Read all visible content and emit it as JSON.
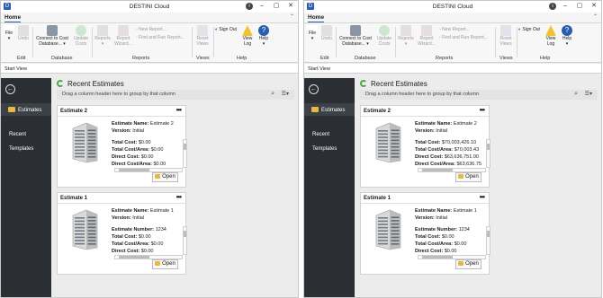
{
  "windows": [
    {
      "title": "DESTINI Cloud",
      "home_tab": "Home",
      "ribbon": {
        "file": "File",
        "undo": "Undo",
        "connect": "Connect to Cost Database...",
        "update": "Update Costs",
        "reports": "Reports",
        "report_wizard": "Report Wizard...",
        "new_report": "New Report...",
        "find_run_report": "Find and Run Report...",
        "reset_views": "Reset Views",
        "view_log": "View Log",
        "sign_out": "Sign Out",
        "help": "Help",
        "groups": {
          "edit": "Edit",
          "database": "Database",
          "reports": "Reports",
          "views": "Views",
          "help": "Help"
        }
      },
      "start_view": "Start View",
      "nav": {
        "estimates": "Estimates",
        "recent": "Recent",
        "templates": "Templates"
      },
      "main": {
        "header": "Recent Estimates",
        "group_hint": "Drag a column header here to group by that column"
      },
      "cards": [
        {
          "title": "Estimate 2",
          "l1": "Estimate Name:",
          "v1": "Estimate 2",
          "l2": "Version:",
          "v2": "Initial",
          "l3": "Total Cost:",
          "v3": "$0.00",
          "l4": "Total Cost/Area:",
          "v4": "$0.00",
          "l5": "Direct Cost:",
          "v5": "$0.00",
          "l6": "Direct Cost/Area:",
          "v6": "$0.00",
          "open": "Open"
        },
        {
          "title": "Estimate 1",
          "l1": "Estimate Name:",
          "v1": "Estimate 1",
          "l2": "Version:",
          "v2": "Initial",
          "l3": "Estimate Number:",
          "v3": "1234",
          "l4": "Total Cost:",
          "v4": "$0.00",
          "l5": "Total Cost/Area:",
          "v5": "$0.00",
          "l6": "Direct Cost:",
          "v6": "$0.00",
          "open": "Open"
        }
      ]
    },
    {
      "title": "DESTINI Cloud",
      "home_tab": "Home",
      "ribbon": {
        "file": "File",
        "undo": "Undo",
        "connect": "Connect to Cost Database...",
        "update": "Update Costs",
        "reports": "Reports",
        "report_wizard": "Report Wizard...",
        "new_report": "New Report...",
        "find_run_report": "Find and Run Report...",
        "reset_views": "Reset Views",
        "view_log": "View Log",
        "sign_out": "Sign Out",
        "help": "Help",
        "groups": {
          "edit": "Edit",
          "database": "Database",
          "reports": "Reports",
          "views": "Views",
          "help": "Help"
        }
      },
      "start_view": "Start View",
      "nav": {
        "estimates": "Estimates",
        "recent": "Recent",
        "templates": "Templates"
      },
      "main": {
        "header": "Recent Estimates",
        "group_hint": "Drag a column header here to group by that column"
      },
      "cards": [
        {
          "title": "Estimate 2",
          "l1": "Estimate Name:",
          "v1": "Estimate 2",
          "l2": "Version:",
          "v2": "Initial",
          "l3": "Total Cost:",
          "v3": "$70,003,426.10",
          "l4": "Total Cost/Area:",
          "v4": "$70,003.43",
          "l5": "Direct Cost:",
          "v5": "$63,636,751.00",
          "l6": "Direct Cost/Area:",
          "v6": "$63,636.75",
          "open": "Open"
        },
        {
          "title": "Estimate 1",
          "l1": "Estimate Name:",
          "v1": "Estimate 1",
          "l2": "Version:",
          "v2": "Initial",
          "l3": "Estimate Number:",
          "v3": "1234",
          "l4": "Total Cost:",
          "v4": "$0.00",
          "l5": "Total Cost/Area:",
          "v5": "$0.00",
          "l6": "Direct Cost:",
          "v6": "$0.00",
          "open": "Open"
        }
      ]
    }
  ]
}
